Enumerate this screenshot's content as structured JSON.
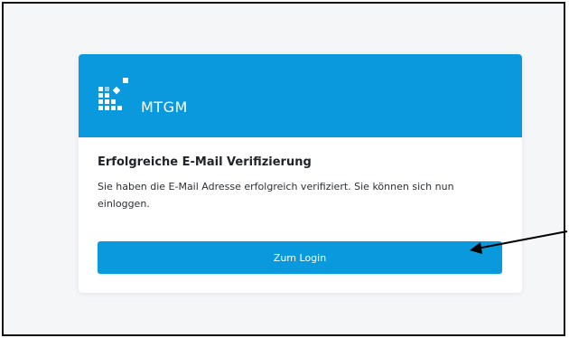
{
  "brand": {
    "name": "MTGM",
    "logo_icon": "mtgm-grid-logo",
    "accent_color": "#0a99dc"
  },
  "card": {
    "title": "Erfolgreiche E-Mail Verifizierung",
    "message": "Sie haben die E-Mail Adresse erfolgreich verifiziert. Sie können sich nun einloggen.",
    "button_label": "Zum Login"
  },
  "annotation": {
    "icon": "arrow-pointer-icon",
    "color": "#000000"
  }
}
